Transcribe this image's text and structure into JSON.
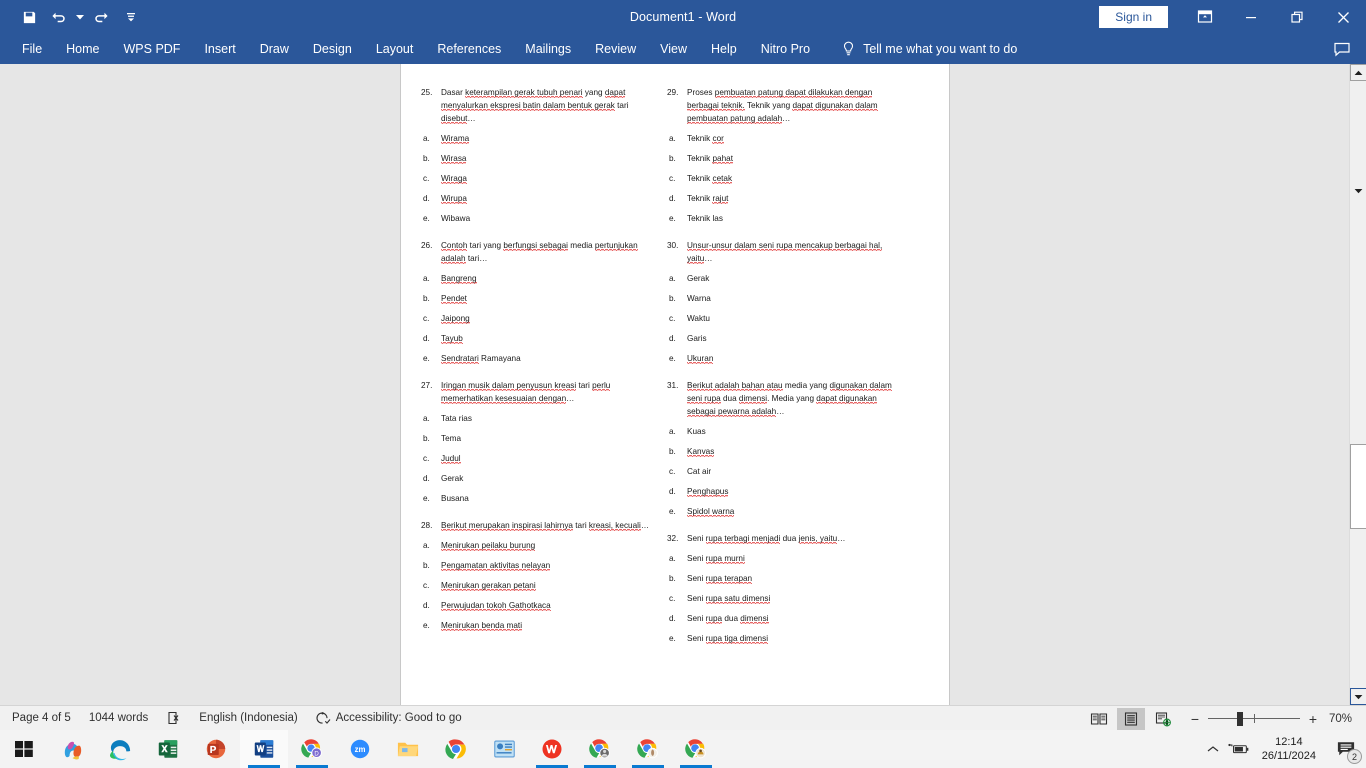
{
  "titlebar": {
    "document_title": "Document1  -  Word",
    "sign_in": "Sign in",
    "quick_access": [
      {
        "name": "save-icon",
        "label": "Save"
      },
      {
        "name": "undo-icon",
        "label": "Undo"
      },
      {
        "name": "redo-icon",
        "label": "Redo"
      },
      {
        "name": "customize-quick-access-icon",
        "label": "Customize Quick Access Toolbar"
      }
    ],
    "window_buttons": [
      {
        "name": "ribbon-display-options-icon",
        "label": "Ribbon Display Options"
      },
      {
        "name": "minimize-icon",
        "label": "Minimize"
      },
      {
        "name": "restore-icon",
        "label": "Restore Down"
      },
      {
        "name": "close-icon",
        "label": "Close"
      }
    ]
  },
  "ribbon": {
    "tabs": [
      {
        "label": "File"
      },
      {
        "label": "Home"
      },
      {
        "label": "WPS PDF"
      },
      {
        "label": "Insert"
      },
      {
        "label": "Draw"
      },
      {
        "label": "Design"
      },
      {
        "label": "Layout"
      },
      {
        "label": "References"
      },
      {
        "label": "Mailings"
      },
      {
        "label": "Review"
      },
      {
        "label": "View"
      },
      {
        "label": "Help"
      },
      {
        "label": "Nitro Pro"
      }
    ],
    "tell_me": "Tell me what you want to do",
    "tell_me_icon": "lightbulb-icon",
    "comments_icon": "comment-icon"
  },
  "document": {
    "left_column": [
      {
        "number": "25.",
        "stem": [
          {
            "t": "Dasar ",
            "sq": false
          },
          {
            "t": "keterampilan gerak tubuh penari",
            "sq": true
          },
          {
            "t": " yang ",
            "sq": false
          },
          {
            "t": "dapat menyalurkan ekspresi batin dalam bentuk gerak",
            "sq": true
          },
          {
            "t": " tari ",
            "sq": false
          },
          {
            "t": "disebut",
            "sq": true
          },
          {
            "t": "…",
            "sq": false
          }
        ],
        "options": [
          {
            "letter": "a.",
            "parts": [
              {
                "t": "Wirama",
                "sq": true
              }
            ]
          },
          {
            "letter": "b.",
            "parts": [
              {
                "t": "Wirasa",
                "sq": true
              }
            ]
          },
          {
            "letter": "c.",
            "parts": [
              {
                "t": "Wiraga",
                "sq": true
              }
            ]
          },
          {
            "letter": "d.",
            "parts": [
              {
                "t": "Wirupa",
                "sq": true
              }
            ]
          },
          {
            "letter": "e.",
            "parts": [
              {
                "t": "Wibawa",
                "sq": false
              }
            ]
          }
        ]
      },
      {
        "number": "26.",
        "stem": [
          {
            "t": "Contoh",
            "sq": true
          },
          {
            "t": " tari yang ",
            "sq": false
          },
          {
            "t": "berfungsi sebagai",
            "sq": true
          },
          {
            "t": " media ",
            "sq": false
          },
          {
            "t": "pertunjukan adalah",
            "sq": true
          },
          {
            "t": " tari…",
            "sq": false
          }
        ],
        "options": [
          {
            "letter": "a.",
            "parts": [
              {
                "t": "Bangreng",
                "sq": true
              }
            ]
          },
          {
            "letter": "b.",
            "parts": [
              {
                "t": "Pendet",
                "sq": true
              }
            ]
          },
          {
            "letter": "c.",
            "parts": [
              {
                "t": "Jaipong",
                "sq": true
              }
            ]
          },
          {
            "letter": "d.",
            "parts": [
              {
                "t": "Tayub",
                "sq": true
              }
            ]
          },
          {
            "letter": "e.",
            "parts": [
              {
                "t": "Sendratari",
                "sq": true
              },
              {
                "t": " Ramayana",
                "sq": false
              }
            ]
          }
        ]
      },
      {
        "number": "27.",
        "stem": [
          {
            "t": "Iringan musik dalam penyusun kreasi",
            "sq": true
          },
          {
            "t": " tari ",
            "sq": false
          },
          {
            "t": "perlu memerhatikan kesesuaian dengan",
            "sq": true
          },
          {
            "t": "…",
            "sq": false
          }
        ],
        "options": [
          {
            "letter": "a.",
            "parts": [
              {
                "t": "Tata rias",
                "sq": false
              }
            ]
          },
          {
            "letter": "b.",
            "parts": [
              {
                "t": "Tema",
                "sq": false
              }
            ]
          },
          {
            "letter": "c.",
            "parts": [
              {
                "t": "Judul",
                "sq": true
              }
            ]
          },
          {
            "letter": "d.",
            "parts": [
              {
                "t": "Gerak",
                "sq": false
              }
            ]
          },
          {
            "letter": "e.",
            "parts": [
              {
                "t": "Busana",
                "sq": false
              }
            ]
          }
        ]
      },
      {
        "number": "28.",
        "stem": [
          {
            "t": "Berikut merupakan inspirasi lahirnya",
            "sq": true
          },
          {
            "t": " tari ",
            "sq": false
          },
          {
            "t": "kreasi, kecuali",
            "sq": true
          },
          {
            "t": "…",
            "sq": false
          }
        ],
        "options": [
          {
            "letter": "a.",
            "parts": [
              {
                "t": "Menirukan peilaku burung",
                "sq": true
              }
            ]
          },
          {
            "letter": "b.",
            "parts": [
              {
                "t": "Pengamatan aktivitas nelayan",
                "sq": true
              }
            ]
          },
          {
            "letter": "c.",
            "parts": [
              {
                "t": "Menirukan gerakan petani",
                "sq": true
              }
            ]
          },
          {
            "letter": "d.",
            "parts": [
              {
                "t": "Perwujudan tokoh Gathotkaca",
                "sq": true
              }
            ]
          },
          {
            "letter": "e.",
            "parts": [
              {
                "t": "Menirukan benda mati",
                "sq": true
              }
            ]
          }
        ]
      }
    ],
    "right_column": [
      {
        "number": "29.",
        "stem": [
          {
            "t": "Proses ",
            "sq": false
          },
          {
            "t": "pembuatan patung dapat dilakukan dengan berbagai teknik.",
            "sq": true
          },
          {
            "t": " Teknik yang ",
            "sq": false
          },
          {
            "t": "dapat digunakan dalam pembuatan patung adalah",
            "sq": true
          },
          {
            "t": "…",
            "sq": false
          }
        ],
        "options": [
          {
            "letter": "a.",
            "parts": [
              {
                "t": "Teknik ",
                "sq": false
              },
              {
                "t": "cor",
                "sq": true
              }
            ]
          },
          {
            "letter": "b.",
            "parts": [
              {
                "t": "Teknik ",
                "sq": false
              },
              {
                "t": "pahat",
                "sq": true
              }
            ]
          },
          {
            "letter": "c.",
            "parts": [
              {
                "t": "Teknik ",
                "sq": false
              },
              {
                "t": "cetak",
                "sq": true
              }
            ]
          },
          {
            "letter": "d.",
            "parts": [
              {
                "t": "Teknik ",
                "sq": false
              },
              {
                "t": "rajut",
                "sq": true
              }
            ]
          },
          {
            "letter": "e.",
            "parts": [
              {
                "t": "Teknik las",
                "sq": false
              }
            ]
          }
        ]
      },
      {
        "number": "30.",
        "stem": [
          {
            "t": "Unsur-unsur dalam seni rupa mencakup berbagai hal, yaitu",
            "sq": true
          },
          {
            "t": "…",
            "sq": false
          }
        ],
        "options": [
          {
            "letter": "a.",
            "parts": [
              {
                "t": "Gerak",
                "sq": false
              }
            ]
          },
          {
            "letter": "b.",
            "parts": [
              {
                "t": "Warna",
                "sq": false
              }
            ]
          },
          {
            "letter": "c.",
            "parts": [
              {
                "t": "Waktu",
                "sq": false
              }
            ]
          },
          {
            "letter": "d.",
            "parts": [
              {
                "t": "Garis",
                "sq": false
              }
            ]
          },
          {
            "letter": "e.",
            "parts": [
              {
                "t": "Ukuran",
                "sq": true
              }
            ]
          }
        ]
      },
      {
        "number": "31.",
        "stem": [
          {
            "t": "Berikut adalah bahan atau",
            "sq": true
          },
          {
            "t": " media yang ",
            "sq": false
          },
          {
            "t": "digunakan dalam seni rupa",
            "sq": true
          },
          {
            "t": " dua ",
            "sq": false
          },
          {
            "t": "dimensi",
            "sq": true
          },
          {
            "t": ". Media yang ",
            "sq": false
          },
          {
            "t": "dapat digunakan sebagai pewarna adalah",
            "sq": true
          },
          {
            "t": "…",
            "sq": false
          }
        ],
        "options": [
          {
            "letter": "a.",
            "parts": [
              {
                "t": "Kuas",
                "sq": false
              }
            ]
          },
          {
            "letter": "b.",
            "parts": [
              {
                "t": "Kanvas",
                "sq": true
              }
            ]
          },
          {
            "letter": "c.",
            "parts": [
              {
                "t": "Cat air",
                "sq": false
              }
            ]
          },
          {
            "letter": "d.",
            "parts": [
              {
                "t": "Penghapus",
                "sq": true
              }
            ]
          },
          {
            "letter": "e.",
            "parts": [
              {
                "t": "Spidol warna",
                "sq": true
              }
            ]
          }
        ]
      },
      {
        "number": "32.",
        "stem": [
          {
            "t": "Seni ",
            "sq": false
          },
          {
            "t": "rupa terbagi menjadi",
            "sq": true
          },
          {
            "t": " dua ",
            "sq": false
          },
          {
            "t": "jenis, yaitu",
            "sq": true
          },
          {
            "t": "…",
            "sq": false
          }
        ],
        "options": [
          {
            "letter": "a.",
            "parts": [
              {
                "t": "Seni ",
                "sq": false
              },
              {
                "t": "rupa murni",
                "sq": true
              }
            ]
          },
          {
            "letter": "b.",
            "parts": [
              {
                "t": "Seni ",
                "sq": false
              },
              {
                "t": "rupa terapan",
                "sq": true
              }
            ]
          },
          {
            "letter": "c.",
            "parts": [
              {
                "t": "Seni ",
                "sq": false
              },
              {
                "t": "rupa satu dimensi",
                "sq": true
              }
            ]
          },
          {
            "letter": "d.",
            "parts": [
              {
                "t": "Seni ",
                "sq": false
              },
              {
                "t": "rupa",
                "sq": true
              },
              {
                "t": " dua ",
                "sq": false
              },
              {
                "t": "dimensi",
                "sq": true
              }
            ]
          },
          {
            "letter": "e.",
            "parts": [
              {
                "t": "Seni ",
                "sq": false
              },
              {
                "t": "rupa tiga dimensi",
                "sq": true
              }
            ]
          }
        ]
      }
    ]
  },
  "statusbar": {
    "page": "Page 4 of 5",
    "words": "1044 words",
    "proofing_icon": "proofing-errors-icon",
    "language": "English (Indonesia)",
    "accessibility": "Accessibility: Good to go",
    "accessibility_icon": "accessibility-icon",
    "views": [
      {
        "name": "read-mode-icon",
        "label": "Read Mode",
        "active": false
      },
      {
        "name": "print-layout-icon",
        "label": "Print Layout",
        "active": true
      },
      {
        "name": "web-layout-icon",
        "label": "Web Layout",
        "active": false
      }
    ],
    "zoom_out": "−",
    "zoom_in": "+",
    "zoom_level": "70%"
  },
  "taskbar": {
    "apps": [
      {
        "name": "start-button",
        "label": "Start",
        "running": false,
        "selected": false
      },
      {
        "name": "copilot-icon",
        "label": "Copilot",
        "running": false,
        "selected": false
      },
      {
        "name": "edge-icon",
        "label": "Microsoft Edge",
        "running": false,
        "selected": false
      },
      {
        "name": "excel-icon",
        "label": "Excel",
        "running": false,
        "selected": false
      },
      {
        "name": "powerpoint-icon",
        "label": "PowerPoint",
        "running": false,
        "selected": false
      },
      {
        "name": "word-icon",
        "label": "Word",
        "running": true,
        "selected": true
      },
      {
        "name": "chrome-profile-d-icon",
        "label": "Chrome",
        "running": true,
        "selected": false
      },
      {
        "name": "zoom-icon",
        "label": "Zoom",
        "running": false,
        "selected": false
      },
      {
        "name": "file-explorer-icon",
        "label": "File Explorer",
        "running": false,
        "selected": false
      },
      {
        "name": "chrome-icon",
        "label": "Google Chrome",
        "running": false,
        "selected": false
      },
      {
        "name": "presentation-app-icon",
        "label": "Presentation",
        "running": false,
        "selected": false
      },
      {
        "name": "wps-office-icon",
        "label": "WPS Office",
        "running": true,
        "selected": false
      },
      {
        "name": "chrome-profile-1-icon",
        "label": "Chrome",
        "running": true,
        "selected": false
      },
      {
        "name": "chrome-profile-2-icon",
        "label": "Chrome",
        "running": true,
        "selected": false
      },
      {
        "name": "chrome-profile-3-icon",
        "label": "Chrome",
        "running": true,
        "selected": false
      }
    ],
    "tray": {
      "show_hidden_icon": "chevron-up-icon",
      "battery_icon": "battery-charging-icon",
      "time": "12:14",
      "date": "26/11/2024",
      "notification_icon": "notifications-icon",
      "notification_count": "2"
    }
  }
}
